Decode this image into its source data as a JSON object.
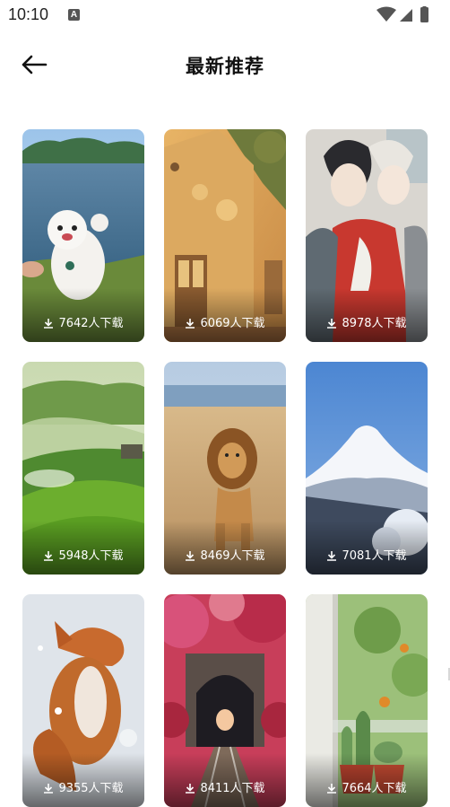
{
  "status": {
    "time": "10:10",
    "badge": "A"
  },
  "header": {
    "title": "最新推荐",
    "back_icon": "arrow-left-icon"
  },
  "download_icon": "download-icon",
  "cards": [
    {
      "downloads": "7642人下载",
      "subject": "white poodle by lake"
    },
    {
      "downloads": "6069人下载",
      "subject": "sunlit building"
    },
    {
      "downloads": "8978人下载",
      "subject": "anime boys"
    },
    {
      "downloads": "5948人下载",
      "subject": "green hills"
    },
    {
      "downloads": "8469人下载",
      "subject": "lion in savanna"
    },
    {
      "downloads": "7081人下载",
      "subject": "snowy mount fuji"
    },
    {
      "downloads": "9355人下载",
      "subject": "fox in snow"
    },
    {
      "downloads": "8411人下载",
      "subject": "railway tunnel"
    },
    {
      "downloads": "7664人下载",
      "subject": "cactus pots by window"
    }
  ]
}
